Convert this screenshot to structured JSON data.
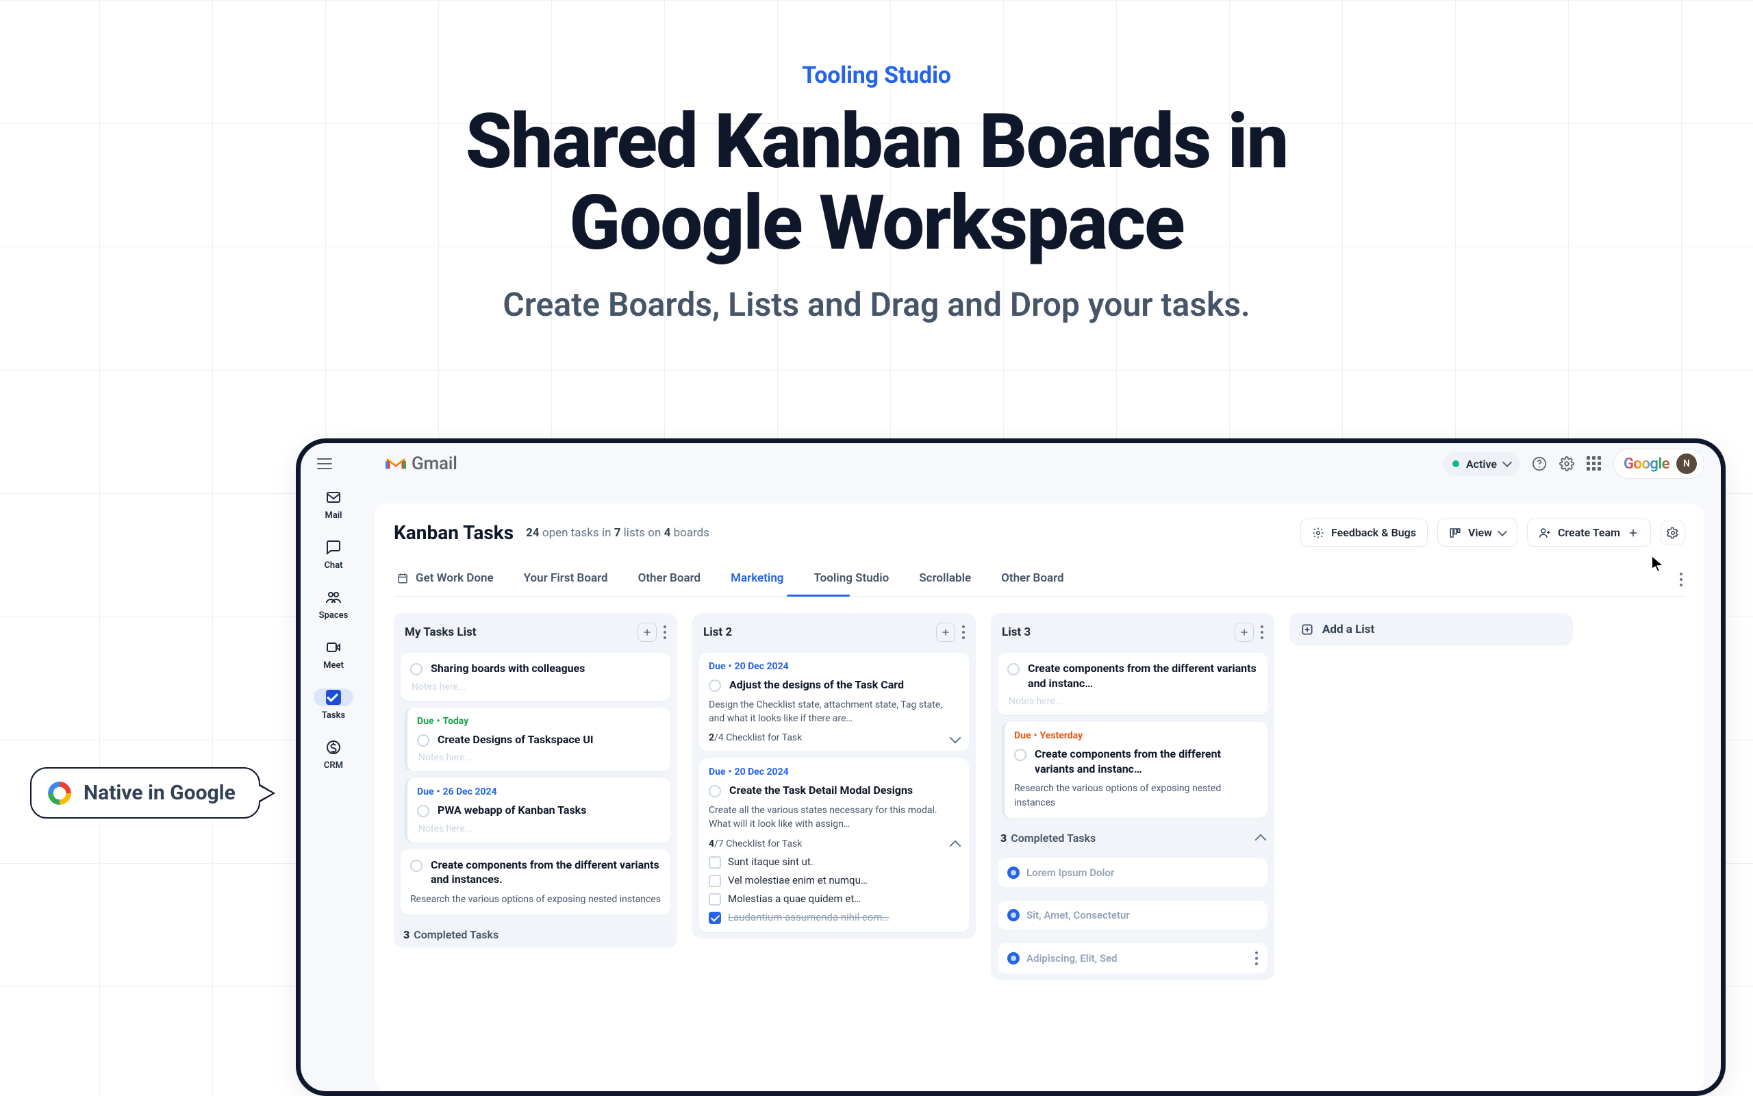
{
  "hero": {
    "brand": "Tooling Studio",
    "title_l1": "Shared Kanban Boards in",
    "title_l2": "Google Workspace",
    "subtitle": "Create Boards, Lists and Drag and Drop your tasks."
  },
  "callout": {
    "text": "Native in Google"
  },
  "topbar": {
    "product": "Gmail",
    "status": "Active",
    "brand_word": "Google",
    "avatar_initial": "N"
  },
  "rail": {
    "items": [
      {
        "key": "mail",
        "label": "Mail"
      },
      {
        "key": "chat",
        "label": "Chat"
      },
      {
        "key": "spaces",
        "label": "Spaces"
      },
      {
        "key": "meet",
        "label": "Meet"
      },
      {
        "key": "tasks",
        "label": "Tasks",
        "active": true
      },
      {
        "key": "crm",
        "label": "CRM"
      }
    ]
  },
  "surface": {
    "title": "Kanban Tasks",
    "meta_open": "24",
    "meta_lists": "7",
    "meta_boards": "4",
    "meta_open_word": "open tasks",
    "meta_in_word": "in",
    "meta_lists_word": "lists",
    "meta_on_word": "on",
    "meta_boards_word": "boards",
    "actions": {
      "feedback": "Feedback & Bugs",
      "view": "View",
      "create_team": "Create Team"
    },
    "tabs": [
      {
        "label": "Get Work Done",
        "icon": true
      },
      {
        "label": "Your First Board"
      },
      {
        "label": "Other Board"
      },
      {
        "label": "Marketing",
        "active": true
      },
      {
        "label": "Tooling Studio"
      },
      {
        "label": "Scrollable"
      },
      {
        "label": "Other Board"
      }
    ]
  },
  "lists": [
    {
      "title": "My Tasks List",
      "cards": [
        {
          "title": "Sharing boards with colleagues",
          "notes": "Notes here..."
        },
        {
          "nested": true,
          "due_kind": "today",
          "due_label": "Due",
          "due_date": "Today",
          "title": "Create Designs of Taskspace UI",
          "notes": "Notes here..."
        },
        {
          "nested": true,
          "due_kind": "normal",
          "due_label": "Due",
          "due_date": "26 Dec 2024",
          "title": "PWA webapp of Kanban Tasks",
          "notes": "Notes here..."
        },
        {
          "title": "Create components from the different variants and instances.",
          "desc": "Research the various options of exposing nested instances"
        }
      ],
      "completed_count": "3",
      "completed_label": "Completed Tasks"
    },
    {
      "title": "List 2",
      "cards": [
        {
          "due_kind": "normal",
          "due_label": "Due",
          "due_date": "20 Dec 2024",
          "title": "Adjust the designs of the Task Card",
          "desc": "Design the Checklist state, attachment state, Tag state, and what it looks like if there are…",
          "check_done": "2",
          "check_total": "4",
          "check_label": "Checklist for Task",
          "check_open": false
        },
        {
          "due_kind": "normal",
          "due_label": "Due",
          "due_date": "20 Dec 2024",
          "title": "Create the Task Detail Modal Designs",
          "desc": "Create all the various states necessary for this modal. What will it look like with assign…",
          "check_done": "4",
          "check_total": "7",
          "check_label": "Checklist for Task",
          "check_open": true,
          "checks": [
            {
              "done": false,
              "text": "Sunt itaque sint ut."
            },
            {
              "done": false,
              "text": "Vel molestiae enim et numqu…"
            },
            {
              "done": false,
              "text": "Molestias a quae quidem et…"
            },
            {
              "done": true,
              "text": "Laudantium assumenda nihil com…"
            }
          ]
        }
      ]
    },
    {
      "title": "List 3",
      "cards": [
        {
          "title": "Create components from the different variants and instanc…",
          "notes": "Notes here..."
        },
        {
          "nested": true,
          "due_kind": "past",
          "due_label": "Due",
          "due_date": "Yesterday",
          "title": "Create components from the different variants and instanc…",
          "desc": "Research the various options of exposing nested instances"
        }
      ],
      "completed_count": "3",
      "completed_label": "Completed Tasks",
      "done_items": [
        {
          "text": "Lorem Ipsum Dolor"
        },
        {
          "text": "Sit, Amet, Consectetur"
        },
        {
          "text": "Adipiscing, Elit, Sed",
          "menu": true
        }
      ]
    }
  ],
  "add_list_label": "Add a List"
}
